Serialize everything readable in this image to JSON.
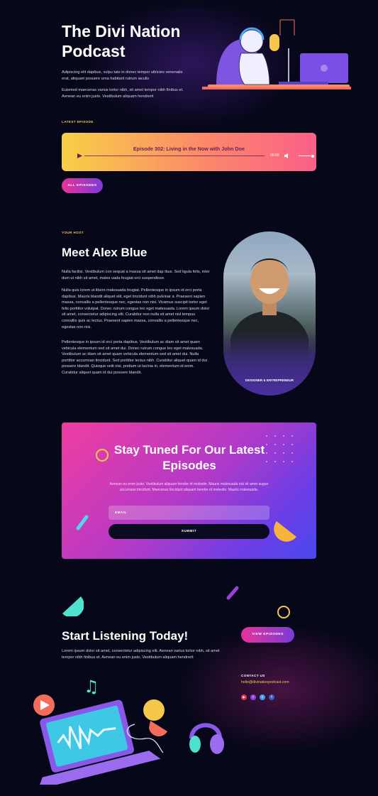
{
  "hero": {
    "title": "The Divi Nation Podcast",
    "para1": "Adipiscing elit dapibus, vulpu tate in donec tempor ultricies venenatis erat, aliquam posuere urna habitant rutrum iaculis",
    "para2": "Euismod maecenas varius tortor nibh, sit amet tempor nibh finibus et. Aenean eu enim justo. Vestibulum aliquam hendrerit",
    "latest_label": "LATEST EPISODE",
    "episode_title": "Episode 302: Living in the Now with John Doe",
    "time": "00:00",
    "all_episodes": "ALL EPISODES"
  },
  "host": {
    "label": "YOUR HOST",
    "title": "Meet Alex Blue",
    "para1": "Nulla facilisi. Vestibulum con sequat a massa sit amet dap ibus. Sed ligula felis, inter dum ut nibh sit amet, males uada feugiat orci suspendisse.",
    "para2": "Nulla quis lorem ut libero malesuada feugiat. Pellentesque in ipsum id orci porta dapibus. Mauris blandit aliquet elit, eget tincidunt nibh pulvinar a. Praesent sapien massa, convallis a pellentesque nec, egestas non nisi. Vivamus suscipit tortor eget felis porttitor volutpat. Donec rutrum congue leo eget malesuada. Lorem ipsum dolor sit amet, consectetur adipiscing elit. Curabitur non nulla sit amet nisl tempus convallis quis ac lectus. Praesent sapien massa, convallis a pellentesque nec, egestas non nisi.",
    "para3": "Pellentesque in ipsum id orci porta dapibus. Vestibulum ac diam sit amet quam vehicula elementum sed sit amet dui. Donec rutrum congue leo eget malesuada. Vestibulum ac diam sit amet quam vehicula elementum sed sit amet dui. Nulla porttitor accumsan tincidunt. Sed porttitor lectus nibh. Curabitur aliquet quam id dui posuere blandit. Quisque velit nisi, pretium ut lacinia in, elementum id enim. Curabitur aliquet quam id dui posuere blandit.",
    "caption": "DESIGNER & ENTREPRENEUR"
  },
  "subscribe": {
    "title": "Stay Tuned For Our Latest Episodes",
    "text": "Aenean eu enim justo. Vestibulum aliquam hendre rit molestie. Mauris malesuada nisi sit amet augue accumsan tincidunt. Maecenas tincidunt aliquam hendre rit molestie. Mauris malesuada.",
    "email_placeholder": "EMAIL",
    "submit": "SUBMIT"
  },
  "listen": {
    "title": "Start Listening Today!",
    "text": "Lorem ipsum dolor sit amet, consectetur adipiscing elit. Aenean varius tortor nibh, sit amet tempor nibh finibus et. Aenean eu enim justo. Vestibulum aliquam hendrerit",
    "view_episodes": "VIEW EPISODES",
    "contact_label": "CONTACT US",
    "email": "hello@divinationpodcast.com"
  },
  "colors": {
    "background": "#07071a",
    "accent_yellow": "#f5c84c",
    "accent_pink": "#e73399",
    "accent_purple": "#7b3bd8"
  },
  "social_icons": [
    "youtube-icon",
    "twitch-icon",
    "twitter-icon",
    "facebook-icon"
  ]
}
